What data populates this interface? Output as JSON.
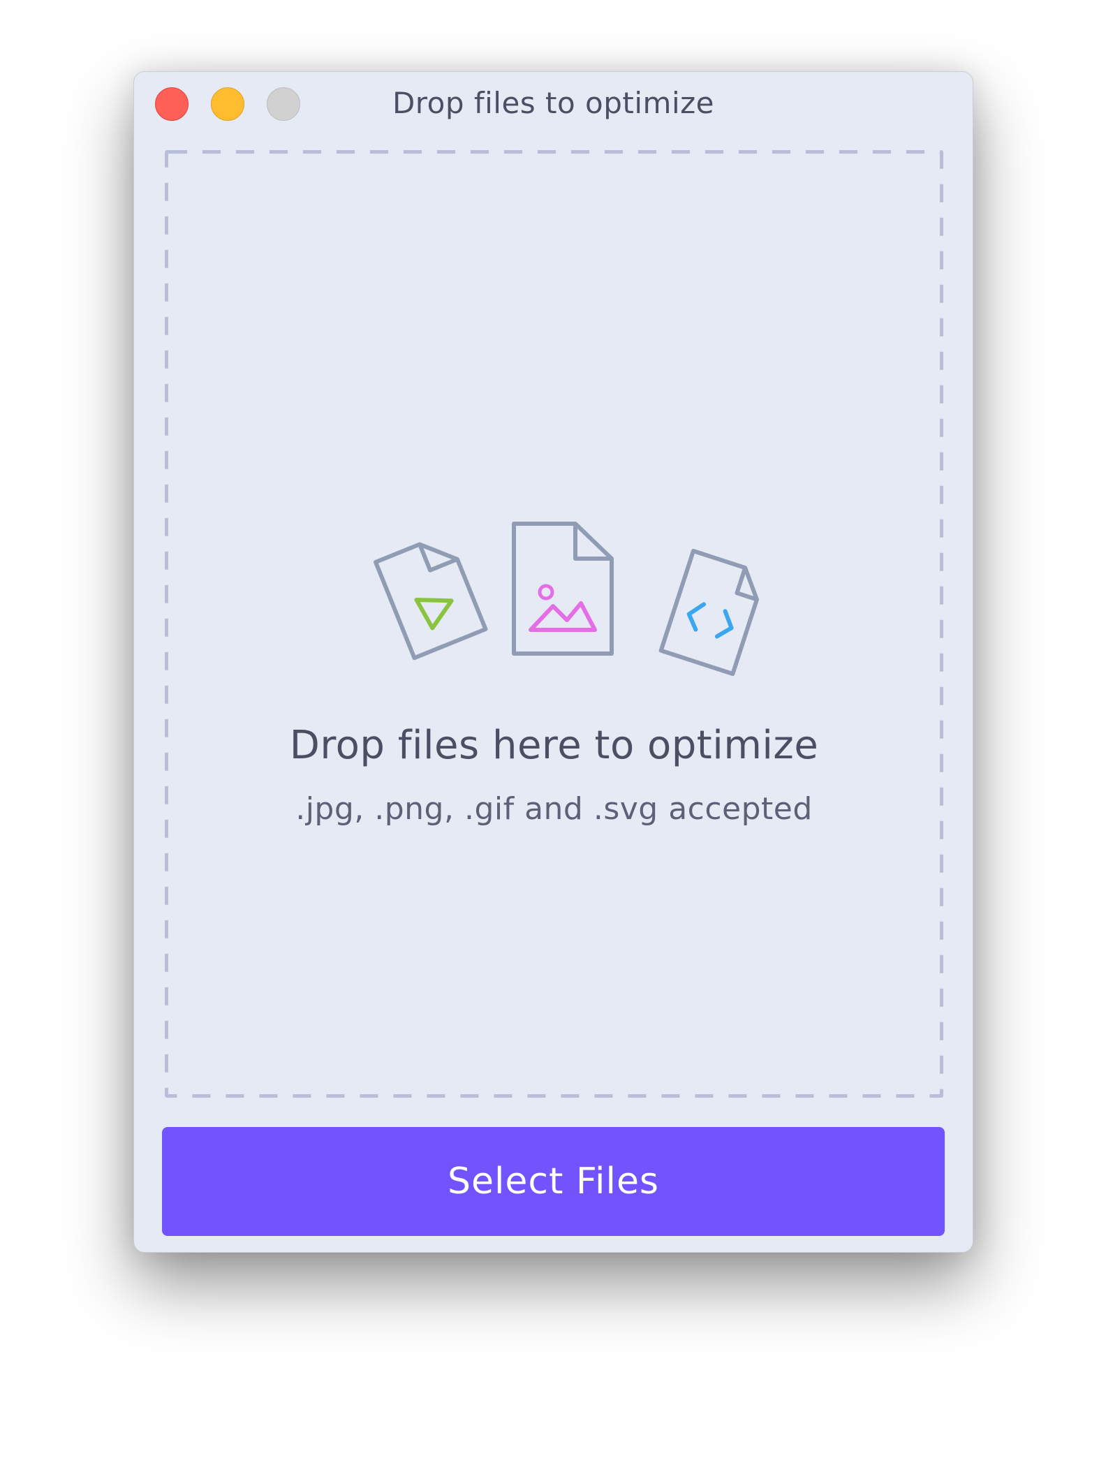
{
  "window": {
    "title": "Drop files to optimize",
    "background_color": "#e6eaf5"
  },
  "traffic_lights": {
    "close": {
      "color": "#fe5f57",
      "icon": "close-dot"
    },
    "minimize": {
      "color": "#febc2e",
      "icon": "minimize-dot"
    },
    "zoom": {
      "color": "#d1d1d1",
      "icon": "zoom-dot-disabled"
    }
  },
  "dropzone": {
    "title": "Drop files here to optimize",
    "subtitle": ".jpg, .png, .gif and .svg accepted",
    "border_color": "#b9bed8",
    "file_icons": [
      {
        "name": "video-file-icon",
        "accent": "#8ac43f"
      },
      {
        "name": "image-file-icon",
        "accent": "#e46ee6"
      },
      {
        "name": "code-file-icon",
        "accent": "#3aa7f0"
      }
    ],
    "icon_outline_color": "#8f9cb3"
  },
  "button": {
    "label": "Select Files",
    "color": "#7254ff"
  }
}
